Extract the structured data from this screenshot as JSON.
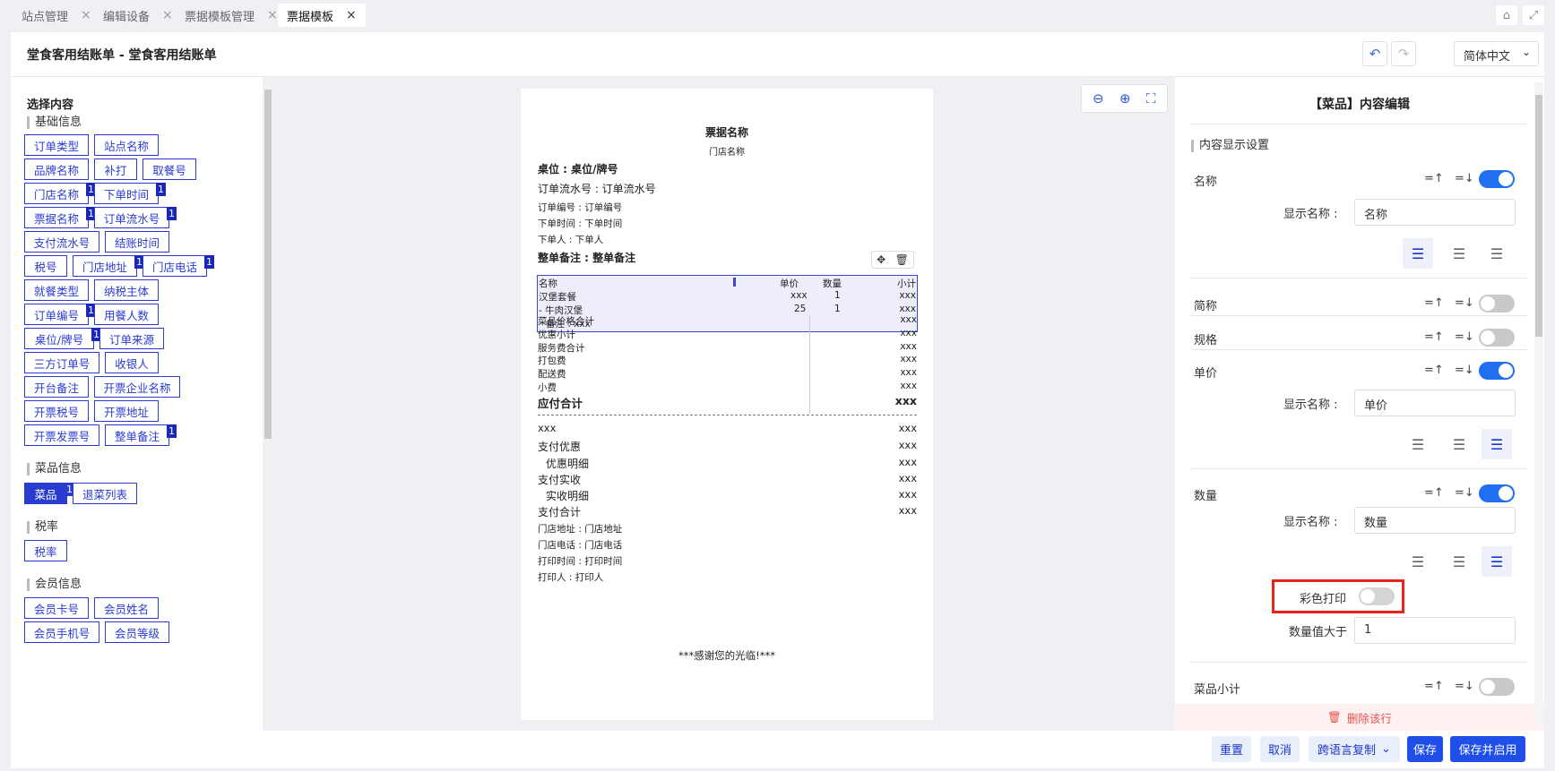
{
  "tabs": [
    {
      "label": "站点管理"
    },
    {
      "label": "编辑设备"
    },
    {
      "label": "票据模板管理"
    },
    {
      "label": "票据模板"
    }
  ],
  "header": {
    "title": "堂食客用结账单 - 堂食客用结账单",
    "language": "简体中文"
  },
  "left": {
    "title": "选择内容",
    "sections": [
      {
        "label": "基础信息"
      },
      {
        "label": "菜品信息"
      },
      {
        "label": "税率"
      },
      {
        "label": "会员信息"
      }
    ],
    "chips": [
      {
        "label": "订单类型"
      },
      {
        "label": "站点名称"
      },
      {
        "label": "品牌名称"
      },
      {
        "label": "补打"
      },
      {
        "label": "取餐号"
      },
      {
        "label": "门店名称",
        "badge": "1"
      },
      {
        "label": "下单时间",
        "badge": "1"
      },
      {
        "label": "票据名称",
        "badge": "1"
      },
      {
        "label": "订单流水号",
        "badge": "1"
      },
      {
        "label": "支付流水号"
      },
      {
        "label": "结账时间"
      },
      {
        "label": "税号"
      },
      {
        "label": "门店地址",
        "badge": "1"
      },
      {
        "label": "门店电话",
        "badge": "1"
      },
      {
        "label": "就餐类型"
      },
      {
        "label": "纳税主体"
      },
      {
        "label": "订单编号",
        "badge": "1"
      },
      {
        "label": "用餐人数"
      },
      {
        "label": "桌位/牌号",
        "badge": "1"
      },
      {
        "label": "订单来源"
      },
      {
        "label": "三方订单号"
      },
      {
        "label": "收银人"
      },
      {
        "label": "开台备注"
      },
      {
        "label": "开票企业名称"
      },
      {
        "label": "开票税号"
      },
      {
        "label": "开票地址"
      },
      {
        "label": "开票发票号"
      },
      {
        "label": "整单备注",
        "badge": "1"
      },
      {
        "label": "菜品",
        "badge": "1"
      },
      {
        "label": "退菜列表"
      },
      {
        "label": "税率"
      },
      {
        "label": "会员卡号"
      },
      {
        "label": "会员姓名"
      },
      {
        "label": "会员手机号"
      },
      {
        "label": "会员等级"
      }
    ]
  },
  "receipt": {
    "title": "票据名称",
    "store": "门店名称",
    "table": "桌位 : 桌位/牌号",
    "serial": "订单流水号 : 订单流水号",
    "order_no": "订单编号 : 订单编号",
    "order_time": "下单时间 : 下单时间",
    "orderer": "下单人 : 下单人",
    "remark": "整单备注 : 整单备注",
    "cols": {
      "name": "名称",
      "price": "单价",
      "qty": "数量",
      "subtotal": "小计"
    },
    "items": [
      {
        "name": "汉堡套餐",
        "price": "xxx",
        "qty": "1",
        "subtotal": "xxx"
      },
      {
        "name": "- 牛肉汉堡",
        "price": "25",
        "qty": "1",
        "subtotal": "xxx"
      }
    ],
    "item_note": "备注 : xxx",
    "totals": [
      {
        "label": "菜品价格合计",
        "value": "xxx"
      },
      {
        "label": "优惠小计",
        "value": "xxx"
      },
      {
        "label": "服务费合计",
        "value": "xxx"
      },
      {
        "label": "打包费",
        "value": "xxx"
      },
      {
        "label": "配送费",
        "value": "xxx"
      },
      {
        "label": "小费",
        "value": "xxx"
      }
    ],
    "payable_label": "应付合计",
    "payable_value": "xxx",
    "pay": [
      {
        "label": "xxx",
        "value": "xxx"
      },
      {
        "label": "支付优惠",
        "value": "xxx"
      },
      {
        "label": "优惠明细",
        "value": "xxx"
      },
      {
        "label": "支付实收",
        "value": "xxx"
      },
      {
        "label": "实收明细",
        "value": "xxx"
      },
      {
        "label": "支付合计",
        "value": "xxx"
      }
    ],
    "footer_lines": [
      {
        "text": "门店地址 : 门店地址"
      },
      {
        "text": "门店电话 : 门店电话"
      },
      {
        "text": "打印时间 : 打印时间"
      },
      {
        "text": "打印人 : 打印人"
      }
    ],
    "thanks": "***感谢您的光临!***"
  },
  "right": {
    "title": "【菜品】内容编辑",
    "section": "内容显示设置",
    "display_name_label": "显示名称 :",
    "color_print_label": "彩色打印",
    "qty_gt_label": "数量值大于",
    "qty_gt_value": "1",
    "rows": [
      {
        "label": "名称",
        "enabled": true,
        "display": "名称"
      },
      {
        "label": "简称",
        "enabled": false
      },
      {
        "label": "规格",
        "enabled": false
      },
      {
        "label": "单价",
        "enabled": true,
        "display": "单价"
      },
      {
        "label": "数量",
        "enabled": true,
        "display": "数量"
      },
      {
        "label": "菜品小计",
        "enabled": false
      }
    ],
    "delete_label": "删除该行",
    "highlight_color": "#e8231c"
  },
  "footer": {
    "reset": "重置",
    "cancel": "取消",
    "copy": "跨语言复制",
    "save": "保存",
    "save_enable": "保存并启用"
  }
}
